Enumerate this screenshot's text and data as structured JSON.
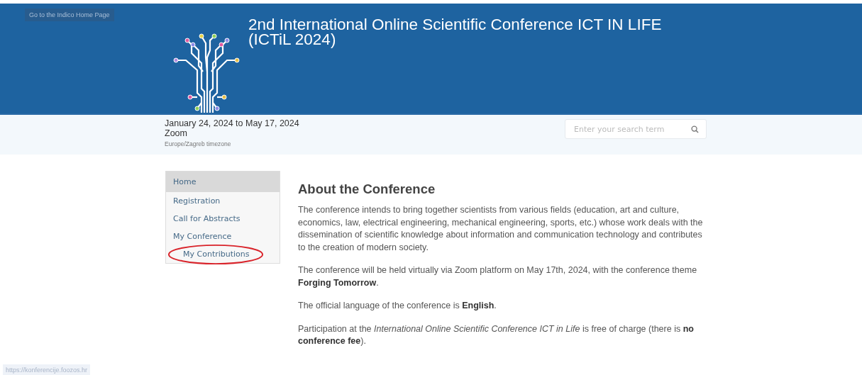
{
  "home_link": {
    "label": "Go to the Indico Home Page"
  },
  "header": {
    "title": "2nd International Online Scientific Conference ICT IN LIFE (ICTiL 2024)"
  },
  "event_info": {
    "dates": "January 24, 2024 to May 17, 2024",
    "location": "Zoom",
    "timezone": "Europe/Zagreb timezone"
  },
  "search": {
    "placeholder": "Enter your search term"
  },
  "sidebar": {
    "items": [
      {
        "label": "Home",
        "selected": true,
        "highlighted": false
      },
      {
        "label": "Registration",
        "selected": false,
        "highlighted": false
      },
      {
        "label": "Call for Abstracts",
        "selected": false,
        "highlighted": false
      },
      {
        "label": "My Conference",
        "selected": false,
        "highlighted": false,
        "children": [
          {
            "label": "My Contributions",
            "selected": false,
            "highlighted": true
          }
        ]
      }
    ]
  },
  "content": {
    "heading": "About the Conference",
    "paragraphs": [
      "The conference intends to bring together scientists from various fields (education, art and culture, economics, law, electrical engineering, mechanical engineering, sports, etc.) whose work deals with the dissemination of scientific knowledge about information and communication technology and contributes to the creation of modern society.",
      "The conference will be held virtually via Zoom platform on May 17th, 2024, with the conference theme **Forging Tomorrow**.",
      "The official language of the conference is **English**.",
      "Participation at the *International Online Scientific Conference ICT in Life* is free of charge (there is **no conference fee**)."
    ]
  },
  "status_bar": {
    "url": "https://konferencije.foozos.hr"
  }
}
